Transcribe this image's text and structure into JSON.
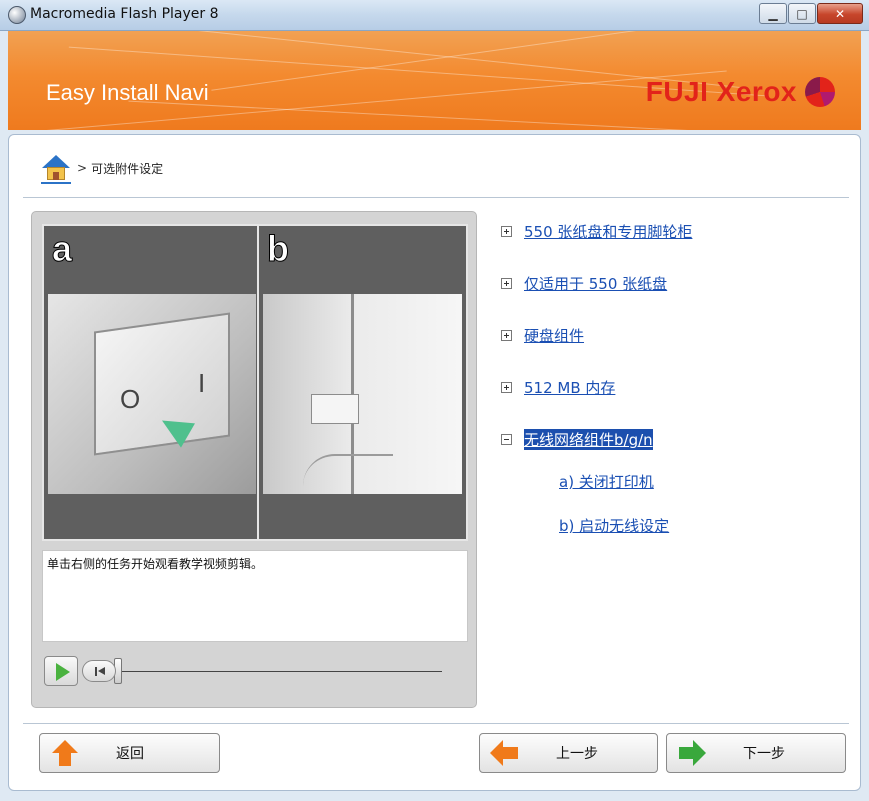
{
  "window": {
    "title": "Macromedia Flash Player 8"
  },
  "banner": {
    "title": "Easy Install Navi",
    "brand": "FUJI Xerox"
  },
  "breadcrumb": {
    "separator": ">",
    "current": "可选附件设定"
  },
  "video": {
    "frame_a_label": "a",
    "frame_b_label": "b",
    "symbol_off": "O",
    "symbol_on": "I",
    "caption": "单击右侧的任务开始观看教学视频剪辑。"
  },
  "menu": {
    "items": [
      {
        "label": "550 张纸盘和专用脚轮柜",
        "state": "collapsed"
      },
      {
        "label": "仅适用于 550 张纸盘",
        "state": "collapsed"
      },
      {
        "label": "硬盘组件",
        "state": "collapsed"
      },
      {
        "label": "512 MB 内存",
        "state": "collapsed"
      },
      {
        "label": "无线网络组件b/g/n",
        "state": "expanded",
        "selected": true
      }
    ],
    "subitems": [
      {
        "label": "a) 关闭打印机"
      },
      {
        "label": "b) 启动无线设定"
      }
    ]
  },
  "buttons": {
    "back": "返回",
    "prev": "上一步",
    "next": "下一步"
  },
  "colors": {
    "banner": "#f38a2f",
    "brand": "#e2231a",
    "link": "#1a4fb3",
    "selected_bg": "#1c4fae"
  }
}
